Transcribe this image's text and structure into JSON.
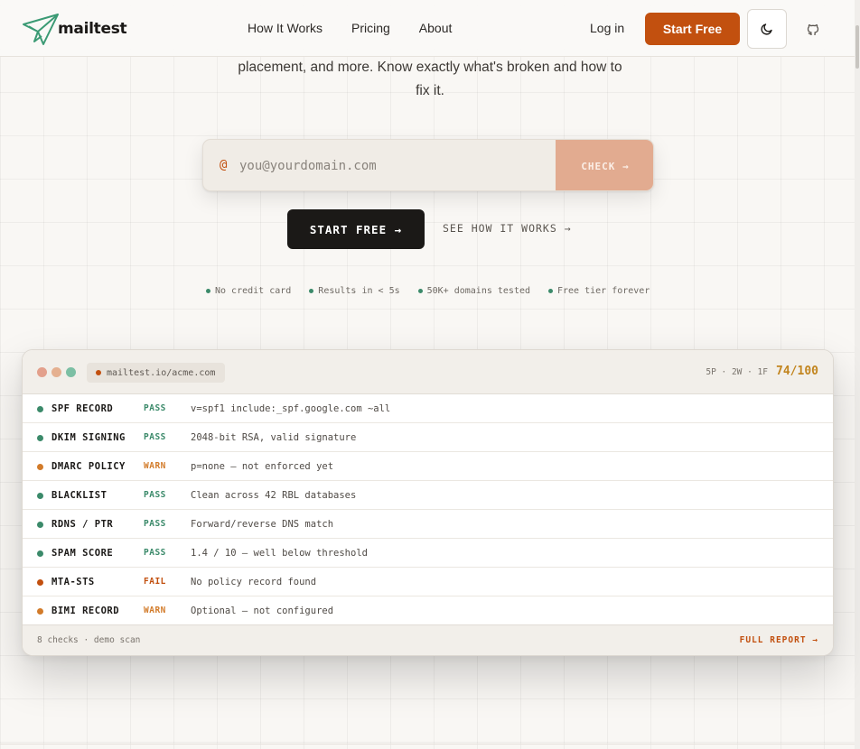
{
  "header": {
    "logo": "mailtest",
    "nav": [
      "How It Works",
      "Pricing",
      "About"
    ],
    "login": "Log in",
    "start": "Start Free",
    "theme_icon": "moon-icon",
    "github_icon": "github-icon"
  },
  "hero": {
    "line1": "placement, and more. Know exactly what's broken and how to",
    "line2": "fix it."
  },
  "form": {
    "at": "@",
    "placeholder": "you@yourdomain.com",
    "check": "CHECK →"
  },
  "cta": {
    "start": "START FREE →",
    "how": "SEE HOW IT WORKS →"
  },
  "features": [
    "No credit card",
    "Results in < 5s",
    "50K+ domains tested",
    "Free tier forever"
  ],
  "panel": {
    "url": "mailtest.io/acme.com",
    "summary": "5P · 2W · 1F",
    "score": "74/100",
    "rows": [
      {
        "name": "SPF RECORD",
        "status": "PASS",
        "detail": "v=spf1 include:_spf.google.com ~all"
      },
      {
        "name": "DKIM SIGNING",
        "status": "PASS",
        "detail": "2048-bit RSA, valid signature"
      },
      {
        "name": "DMARC POLICY",
        "status": "WARN",
        "detail": "p=none — not enforced yet"
      },
      {
        "name": "BLACKLIST",
        "status": "PASS",
        "detail": "Clean across 42 RBL databases"
      },
      {
        "name": "RDNS / PTR",
        "status": "PASS",
        "detail": "Forward/reverse DNS match"
      },
      {
        "name": "SPAM SCORE",
        "status": "PASS",
        "detail": "1.4 / 10 — well below threshold"
      },
      {
        "name": "MTA-STS",
        "status": "FAIL",
        "detail": "No policy record found"
      },
      {
        "name": "BIMI RECORD",
        "status": "WARN",
        "detail": "Optional — not configured"
      }
    ],
    "footer_left": "8 checks · demo scan",
    "footer_right": "FULL REPORT →"
  },
  "colors": {
    "accent": "#c2500f",
    "pass": "#3b8a6a",
    "warn": "#d27b2a",
    "fail": "#c2500f"
  }
}
